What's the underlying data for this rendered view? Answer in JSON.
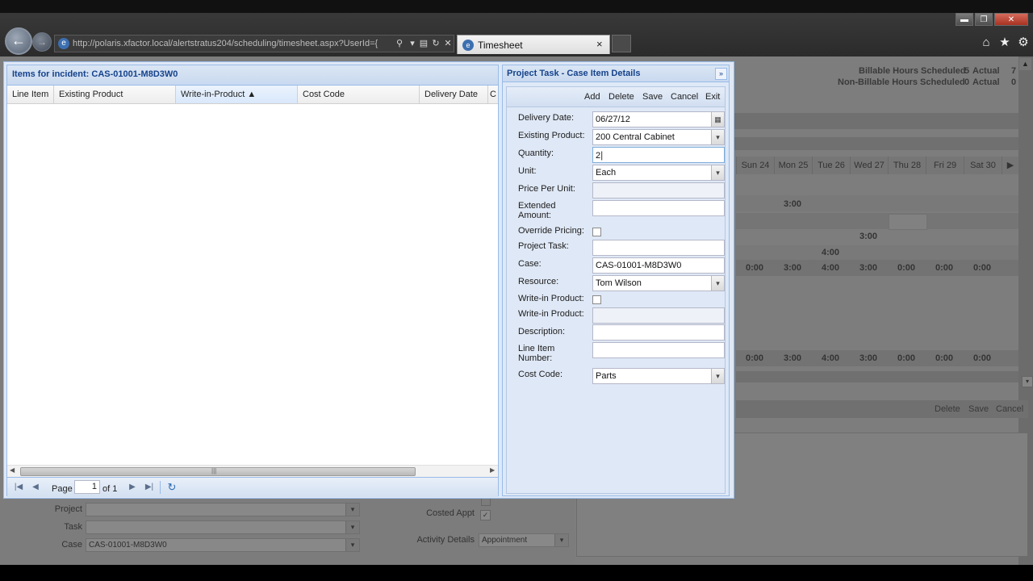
{
  "browser": {
    "url": "http://polaris.xfactor.local/alertstratus204/scheduling/timesheet.aspx?UserId={",
    "tab_title": "Timesheet",
    "tab_close": "×",
    "window_minimize": "▬",
    "window_maximize": "❐",
    "window_close": "✕",
    "icons": [
      "back-icon",
      "forward-icon",
      "search-icon",
      "compat-icon",
      "refresh-icon",
      "stop-icon",
      "home-icon",
      "favorites-icon",
      "settings-icon"
    ]
  },
  "background": {
    "billable_label": "Billable Hours Scheduled",
    "billable_scheduled": "5",
    "billable_actual_label": "Actual",
    "billable_actual": "7",
    "nonbillable_label": "Non-Billable Hours Scheduled",
    "nonbillable_scheduled": "0",
    "nonbillable_actual_label": "Actual",
    "nonbillable_actual": "0",
    "days": [
      "Sun 24",
      "Mon 25",
      "Tue 26",
      "Wed 27",
      "Thu 28",
      "Fri 29",
      "Sat 30"
    ],
    "row_values": {
      "mon_300": "3:00",
      "thu_300": "3:00",
      "tue_400": "4:00"
    },
    "totals_row_1": [
      "0:00",
      "3:00",
      "4:00",
      "3:00",
      "0:00",
      "0:00",
      "0:00"
    ],
    "totals_row_2": [
      "0:00",
      "3:00",
      "4:00",
      "3:00",
      "0:00",
      "0:00",
      "0:00"
    ],
    "actions": {
      "delete": "Delete",
      "save": "Save",
      "cancel": "Cancel"
    },
    "form": {
      "project_label": "Project",
      "task_label": "Task",
      "case_label": "Case",
      "case_value": "CAS-01001-M8D3W0",
      "costed_label": "Costed Appt",
      "activity_label": "Activity Details",
      "activity_value": "Appointment"
    }
  },
  "items_panel": {
    "title": "Items for incident: CAS-01001-M8D3W0",
    "columns": [
      "Line Item",
      "Existing Product",
      "Write-in-Product ▲",
      "Cost Code",
      "Delivery Date",
      "C"
    ],
    "pager": {
      "page_label": "Page",
      "page_value": "1",
      "of_label": "of 1"
    }
  },
  "details_panel": {
    "title": "Project Task - Case Item Details",
    "collapse": "»",
    "toolbar": {
      "add": "Add",
      "delete": "Delete",
      "save": "Save",
      "cancel": "Cancel",
      "exit": "Exit"
    },
    "fields": {
      "delivery_date_label": "Delivery Date:",
      "delivery_date_value": "06/27/12",
      "existing_product_label": "Existing Product:",
      "existing_product_value": "200 Central Cabinet",
      "quantity_label": "Quantity:",
      "quantity_value": "2",
      "unit_label": "Unit:",
      "unit_value": "Each",
      "price_per_unit_label": "Price Per Unit:",
      "price_per_unit_value": "",
      "extended_amount_label": "Extended Amount:",
      "extended_amount_value": "",
      "override_pricing_label": "Override Pricing:",
      "project_task_label": "Project Task:",
      "project_task_value": "",
      "case_label": "Case:",
      "case_value": "CAS-01001-M8D3W0",
      "resource_label": "Resource:",
      "resource_value": "Tom Wilson",
      "write_in_product_check_label": "Write-in Product:",
      "write_in_product_label": "Write-in Product:",
      "write_in_product_value": "",
      "description_label": "Description:",
      "description_value": "",
      "line_item_number_label": "Line Item Number:",
      "line_item_number_value": "",
      "cost_code_label": "Cost Code:",
      "cost_code_value": "Parts"
    }
  }
}
